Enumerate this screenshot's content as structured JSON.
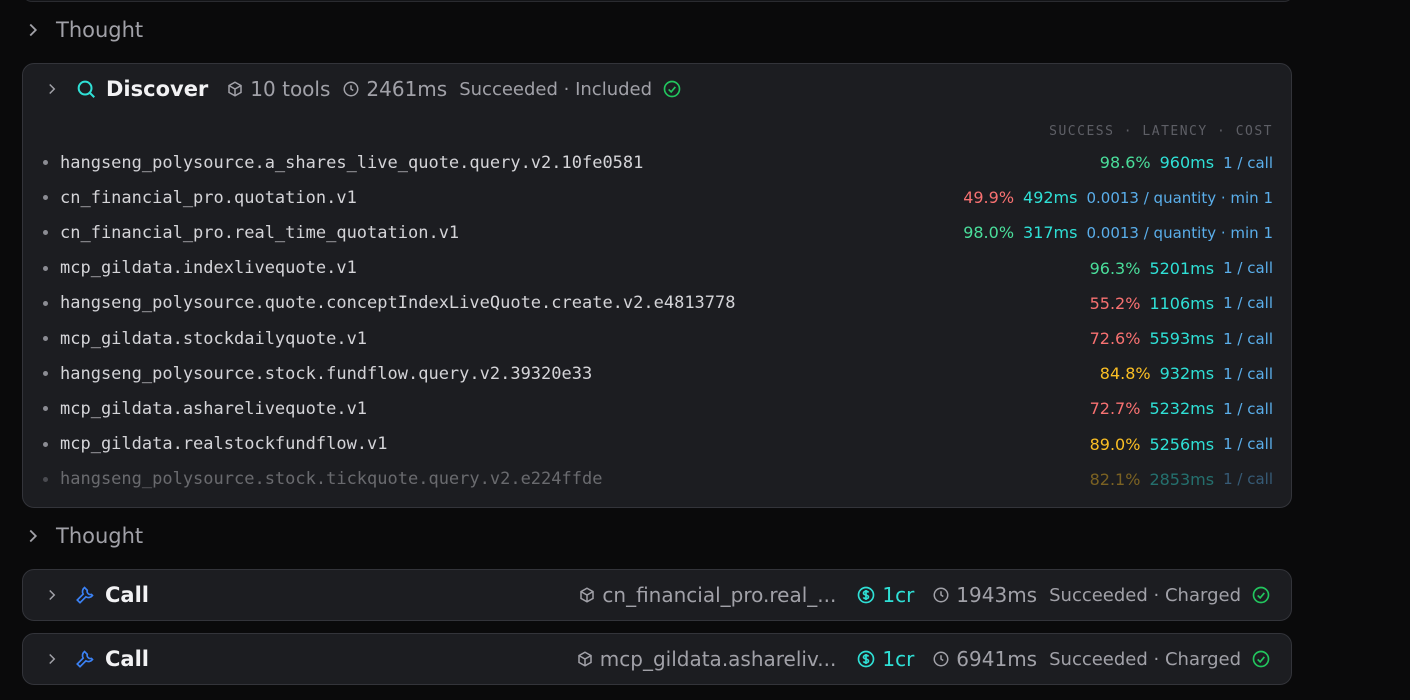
{
  "thought_label": "Thought",
  "discover": {
    "title": "Discover",
    "tools": "10 tools",
    "duration": "2461ms",
    "status": "Succeeded · Included",
    "columns": "SUCCESS · LATENCY · COST",
    "rows": [
      {
        "name": "hangseng_polysource.a_shares_live_quote.query.v2.10fe0581",
        "success": "98.6%",
        "latency": "960ms",
        "cost": "1 / call",
        "tone": "g"
      },
      {
        "name": "cn_financial_pro.quotation.v1",
        "success": "49.9%",
        "latency": "492ms",
        "cost": "0.0013 / quantity · min 1",
        "tone": "r"
      },
      {
        "name": "cn_financial_pro.real_time_quotation.v1",
        "success": "98.0%",
        "latency": "317ms",
        "cost": "0.0013 / quantity · min 1",
        "tone": "g"
      },
      {
        "name": "mcp_gildata.indexlivequote.v1",
        "success": "96.3%",
        "latency": "5201ms",
        "cost": "1 / call",
        "tone": "g"
      },
      {
        "name": "hangseng_polysource.quote.conceptIndexLiveQuote.create.v2.e4813778",
        "success": "55.2%",
        "latency": "1106ms",
        "cost": "1 / call",
        "tone": "r"
      },
      {
        "name": "mcp_gildata.stockdailyquote.v1",
        "success": "72.6%",
        "latency": "5593ms",
        "cost": "1 / call",
        "tone": "r"
      },
      {
        "name": "hangseng_polysource.stock.fundflow.query.v2.39320e33",
        "success": "84.8%",
        "latency": "932ms",
        "cost": "1 / call",
        "tone": "y"
      },
      {
        "name": "mcp_gildata.asharelivequote.v1",
        "success": "72.7%",
        "latency": "5232ms",
        "cost": "1 / call",
        "tone": "r"
      },
      {
        "name": "mcp_gildata.realstockfundflow.v1",
        "success": "89.0%",
        "latency": "5256ms",
        "cost": "1 / call",
        "tone": "y"
      },
      {
        "name": "hangseng_polysource.stock.tickquote.query.v2.e224ffde",
        "success": "82.1%",
        "latency": "2853ms",
        "cost": "1 / call",
        "tone": "y"
      }
    ]
  },
  "calls": [
    {
      "title": "Call",
      "tool": "cn_financial_pro.real_...",
      "credits": "1cr",
      "duration": "1943ms",
      "status": "Succeeded · Charged"
    },
    {
      "title": "Call",
      "tool": "mcp_gildata.ashareliv...",
      "credits": "1cr",
      "duration": "6941ms",
      "status": "Succeeded · Charged"
    }
  ],
  "colors": {
    "accent": "#2fe0d6",
    "success": "#22c55e",
    "wrench": "#3b82f6"
  },
  "icons": [
    "chevron-right-icon",
    "search-icon",
    "cube-icon",
    "clock-icon",
    "check-circle-icon",
    "wrench-icon",
    "dollar-icon"
  ]
}
